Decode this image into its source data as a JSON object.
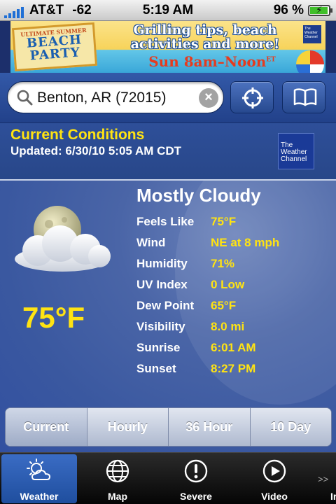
{
  "status_bar": {
    "carrier": "AT&T",
    "signal_text": "-62",
    "time": "5:19 AM",
    "battery_percent": "96 %",
    "battery_level": 0.96
  },
  "ad": {
    "badge_small": "ULTIMATE SUMMER",
    "badge_big_1": "BEACH",
    "badge_big_2": "PARTY",
    "line1": "Grilling tips, beach",
    "line2": "activities and more!",
    "line3": "Sun 8am–Noon",
    "line3_suffix": "ET",
    "logo_text": "The Weather Channel"
  },
  "search": {
    "value": "Benton, AR (72015)",
    "clear_symbol": "×"
  },
  "current_conditions": {
    "title": "Current Conditions",
    "updated": "Updated: 6/30/10 5:05 AM CDT",
    "logo_line1": "The",
    "logo_line2": "Weather",
    "logo_line3": "Channel"
  },
  "weather": {
    "condition": "Mostly Cloudy",
    "temperature": "75°F",
    "icon": "moon-partly-cloudy-icon",
    "details": [
      {
        "label": "Feels Like",
        "value": "75°F"
      },
      {
        "label": "Wind",
        "value": "NE at 8 mph"
      },
      {
        "label": "Humidity",
        "value": "71%"
      },
      {
        "label": "UV Index",
        "value": "0 Low"
      },
      {
        "label": "Dew Point",
        "value": "65°F"
      },
      {
        "label": "Visibility",
        "value": "8.0 mi"
      },
      {
        "label": "Sunrise",
        "value": "6:01 AM"
      },
      {
        "label": "Sunset",
        "value": "8:27 PM"
      }
    ]
  },
  "segments": [
    "Current",
    "Hourly",
    "36 Hour",
    "10 Day"
  ],
  "tabs": [
    {
      "label": "Weather",
      "icon": "weather-icon"
    },
    {
      "label": "Map",
      "icon": "globe-icon"
    },
    {
      "label": "Severe",
      "icon": "alert-icon"
    },
    {
      "label": "Video",
      "icon": "play-icon"
    }
  ],
  "more_tabs": {
    "arrows": ">>",
    "label": "Ir"
  },
  "colors": {
    "accent_yellow": "#ffe312",
    "background_blue": "#3a58a0",
    "tab_active": "#2f61b8"
  }
}
